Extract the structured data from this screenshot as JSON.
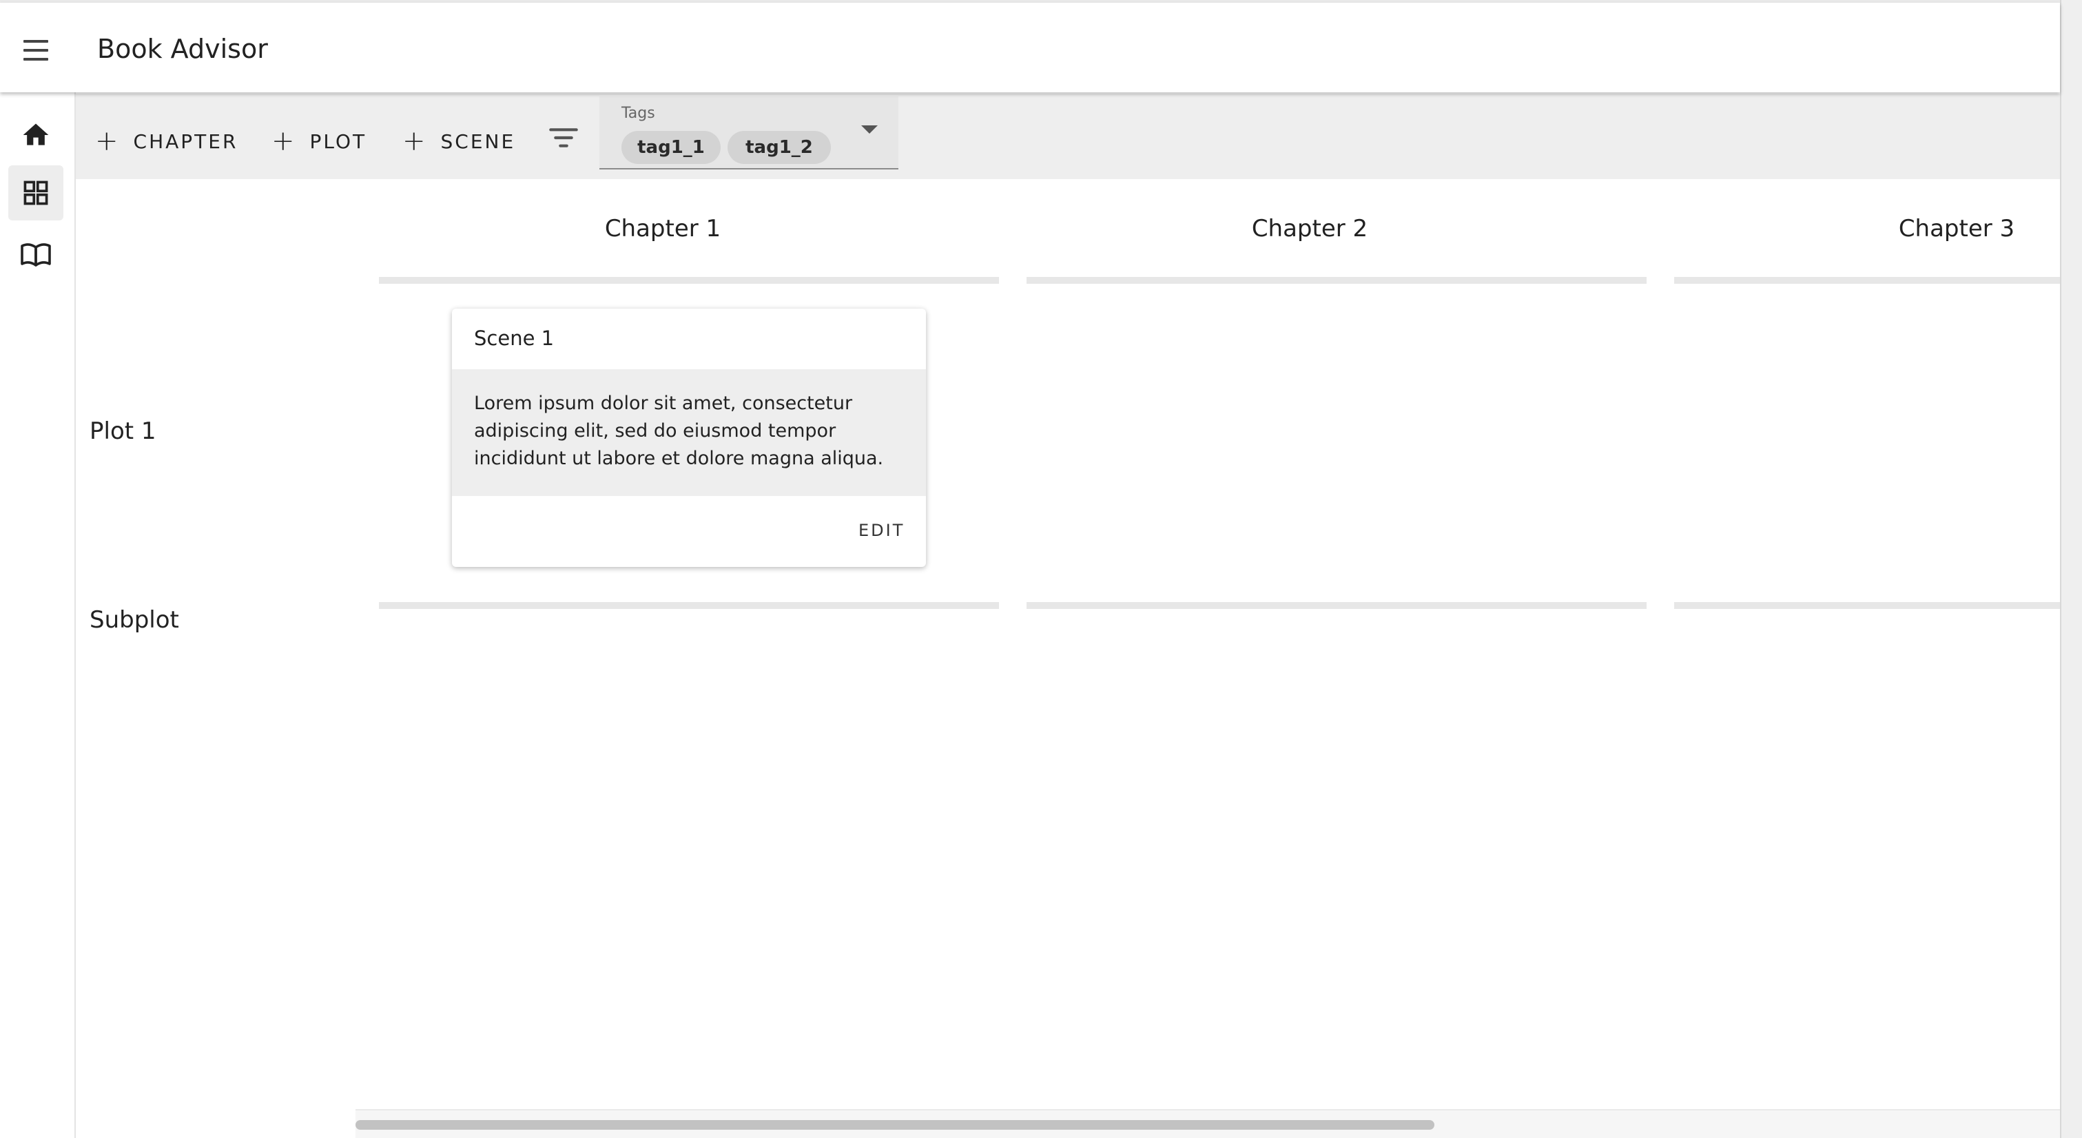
{
  "app": {
    "title": "Book Advisor"
  },
  "sidebar": {
    "items": [
      {
        "icon": "home-icon",
        "active": false
      },
      {
        "icon": "grid-icon",
        "active": true
      },
      {
        "icon": "book-icon",
        "active": false
      }
    ],
    "bottom_icon": "edit-off-icon"
  },
  "toolbar": {
    "add_chapter_label": "CHAPTER",
    "add_plot_label": "PLOT",
    "add_scene_label": "SCENE",
    "plus_symbol": "+",
    "tags": {
      "label": "Tags",
      "selected": [
        "tag1_1",
        "tag1_2"
      ]
    }
  },
  "board": {
    "chapters": [
      "Chapter 1",
      "Chapter 2",
      "Chapter 3"
    ],
    "plots": [
      "Plot 1",
      "Subplot"
    ],
    "scene_card": {
      "title": "Scene 1",
      "text": "Lorem ipsum dolor sit amet, consectetur adipiscing elit, sed do eiusmod tempor incididunt ut labore et dolore magna aliqua.",
      "edit_label": "EDIT"
    }
  },
  "colors": {
    "toolbar_bg": "#eeeeee",
    "chip_bg": "#d3d3d3",
    "active_nav_bg": "#ededed"
  }
}
